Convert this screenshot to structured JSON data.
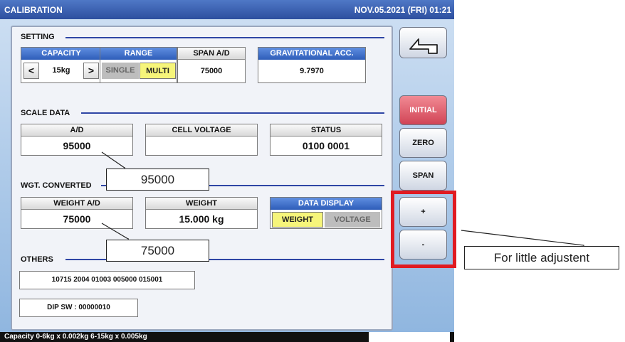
{
  "titlebar": {
    "title": "CALIBRATION",
    "datetime": "NOV.05.2021 (FRI)  01:21"
  },
  "setting": {
    "section_title": "SETTING",
    "capacity": {
      "label": "CAPACITY",
      "value": "15kg",
      "prev": "<",
      "next": ">"
    },
    "range": {
      "label": "RANGE",
      "option_single": "SINGLE",
      "option_multi": "MULTI",
      "selected": "MULTI"
    },
    "span_ad": {
      "label": "SPAN A/D",
      "value": "75000"
    },
    "grav_acc": {
      "label": "GRAVITATIONAL ACC.",
      "value": "9.7970"
    }
  },
  "scale_data": {
    "section_title": "SCALE DATA",
    "ad": {
      "label": "A/D",
      "value": "95000"
    },
    "cell_voltage": {
      "label": "CELL VOLTAGE",
      "value": ""
    },
    "status": {
      "label": "STATUS",
      "value": "0100 0001"
    }
  },
  "wgt_converted": {
    "section_title": "WGT. CONVERTED",
    "weight_ad": {
      "label": "WEIGHT A/D",
      "value": "75000"
    },
    "weight": {
      "label": "WEIGHT",
      "value": "15.000 kg"
    },
    "data_display": {
      "label": "DATA DISPLAY",
      "option_weight": "WEIGHT",
      "option_voltage": "VOLTAGE",
      "selected": "WEIGHT"
    }
  },
  "others": {
    "section_title": "OTHERS",
    "code": "10715 2004 01003 005000 015001",
    "dip_sw": "DIP SW : 00000010"
  },
  "side_buttons": {
    "back_icon": "return-arrow-icon",
    "initial": "INITIAL",
    "zero": "ZERO",
    "span": "SPAN",
    "plus": "+",
    "minus": "-"
  },
  "footer": {
    "capacity_info": "Capacity 0-6kg x 0.002kg  6-15kg x 0.005kg"
  },
  "annotations": {
    "callout_ad": "95000",
    "callout_weight_ad": "75000",
    "callout_adjust": "For little adjustent"
  },
  "colors": {
    "accent_blue": "#2e5db9",
    "selected_yellow": "#f6f57a",
    "initial_red": "#d14455",
    "annotation_red": "#e01b22"
  }
}
